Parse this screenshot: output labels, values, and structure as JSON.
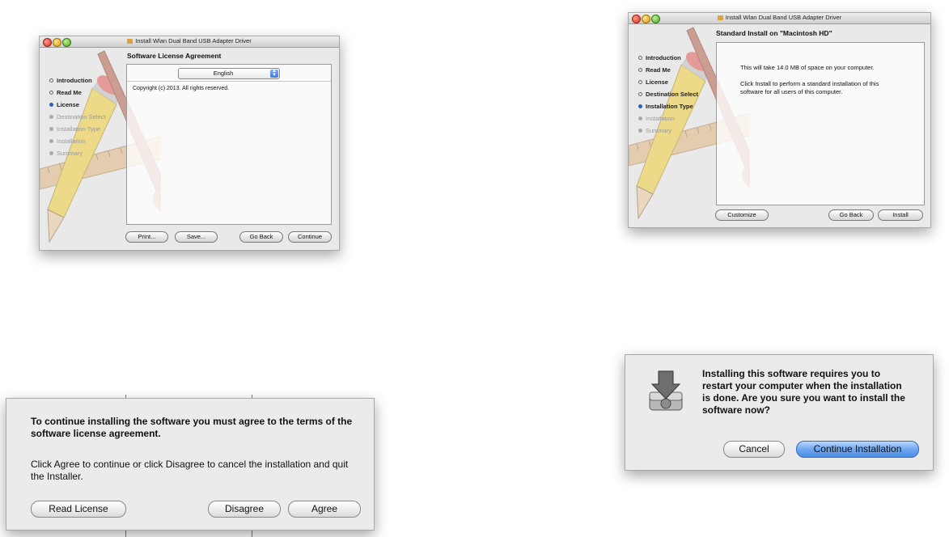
{
  "license_window": {
    "title": "Install Wlan Dual Band USB Adapter Driver",
    "heading": "Software License Agreement",
    "steps": [
      {
        "label": "Introduction",
        "state": "done"
      },
      {
        "label": "Read Me",
        "state": "done"
      },
      {
        "label": "License",
        "state": "current"
      },
      {
        "label": "Destination Select",
        "state": "pending"
      },
      {
        "label": "Installation Type",
        "state": "pending"
      },
      {
        "label": "Installation",
        "state": "pending"
      },
      {
        "label": "Summary",
        "state": "pending"
      }
    ],
    "language_popup": "English",
    "license_text": "Copyright (c) 2013.  All rights reserved.",
    "buttons": {
      "print": "Print...",
      "save": "Save...",
      "go_back": "Go Back",
      "continue": "Continue"
    }
  },
  "install_window": {
    "title": "Install Wlan Dual Band USB Adapter Driver",
    "heading": "Standard Install on \"Macintosh HD\"",
    "steps": [
      {
        "label": "Introduction",
        "state": "done"
      },
      {
        "label": "Read Me",
        "state": "done"
      },
      {
        "label": "License",
        "state": "done"
      },
      {
        "label": "Destination Select",
        "state": "done"
      },
      {
        "label": "Installation Type",
        "state": "current"
      },
      {
        "label": "Installation",
        "state": "pending"
      },
      {
        "label": "Summary",
        "state": "pending"
      }
    ],
    "space_text": "This will take 14.0 MB of space on your computer.",
    "standard_text": "Click Install to perform a standard installation of this software for all users of this computer.",
    "buttons": {
      "customize": "Customize",
      "go_back": "Go Back",
      "install": "Install"
    }
  },
  "agree_sheet": {
    "message_bold": "To continue installing the software you must agree to the terms of the software license agreement.",
    "message": "Click Agree to continue or click Disagree to cancel the installation and quit the Installer.",
    "buttons": {
      "read_license": "Read License",
      "disagree": "Disagree",
      "agree": "Agree"
    }
  },
  "restart_sheet": {
    "message": "Installing this software requires you to restart your computer when the installation is done. Are you sure you want to install the software now?",
    "icon": "installer-disk-icon",
    "buttons": {
      "cancel": "Cancel",
      "continue_installation": "Continue Installation"
    }
  },
  "colors": {
    "current_step": "#2b61c6",
    "default_button": "#4e8ee6"
  }
}
